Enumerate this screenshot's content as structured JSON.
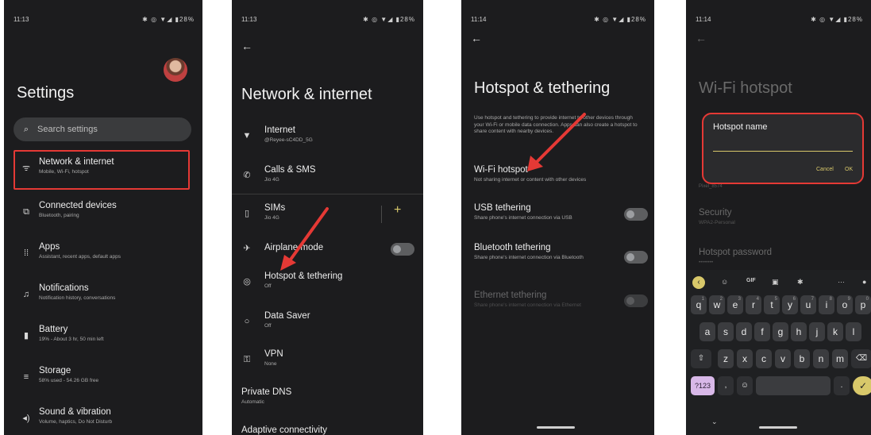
{
  "panel1": {
    "status_time": "11:13",
    "status_icons": "✱ ◎ ▼◢ ▮28%",
    "title": "Settings",
    "search_placeholder": "Search settings",
    "items": [
      {
        "title": "Network & internet",
        "sub": "Mobile, Wi-Fi, hotspot"
      },
      {
        "title": "Connected devices",
        "sub": "Bluetooth, pairing"
      },
      {
        "title": "Apps",
        "sub": "Assistant, recent apps, default apps"
      },
      {
        "title": "Notifications",
        "sub": "Notification history, conversations"
      },
      {
        "title": "Battery",
        "sub": "19% - About 3 hr, 50 min left"
      },
      {
        "title": "Storage",
        "sub": "58% used - 54.26 GB free"
      },
      {
        "title": "Sound & vibration",
        "sub": "Volume, haptics, Do Not Disturb"
      }
    ]
  },
  "panel2": {
    "status_time": "11:13",
    "status_icons": "✱ ◎ ▼◢ ▮28%",
    "title": "Network & internet",
    "items": [
      {
        "title": "Internet",
        "sub": "@Reyee-sC4DD_5G"
      },
      {
        "title": "Calls & SMS",
        "sub": "Jio 4G"
      },
      {
        "title": "SIMs",
        "sub": "Jio 4G"
      },
      {
        "title": "Airplane mode",
        "sub": ""
      },
      {
        "title": "Hotspot & tethering",
        "sub": "Off"
      },
      {
        "title": "Data Saver",
        "sub": "Off"
      },
      {
        "title": "VPN",
        "sub": "None"
      },
      {
        "title": "Private DNS",
        "sub": "Automatic"
      },
      {
        "title": "Adaptive connectivity",
        "sub": ""
      }
    ]
  },
  "panel3": {
    "status_time": "11:14",
    "status_icons": "✱ ◎ ▼◢ ▮28%",
    "title": "Hotspot & tethering",
    "description": "Use hotspot and tethering to provide internet to other devices through your Wi-Fi or mobile data connection. Apps can also create a hotspot to share content with nearby devices.",
    "wifi_title": "Wi-Fi hotspot",
    "wifi_sub": "Not sharing internet or content with other devices",
    "usb_title": "USB tethering",
    "usb_sub": "Share phone's internet connection via USB",
    "bt_title": "Bluetooth tethering",
    "bt_sub": "Share phone's internet connection via Bluetooth",
    "eth_title": "Ethernet tethering",
    "eth_sub": "Share phone's internet connection via Ethernet"
  },
  "panel4": {
    "status_time": "11:14",
    "status_icons": "✱ ◎ ▼◢ ▮28%",
    "title": "Wi-Fi hotspot",
    "dialog_title": "Hotspot name",
    "cancel": "Cancel",
    "ok": "OK",
    "bg_name_value": "Pixel_8574",
    "security_title": "Security",
    "security_sub": "WPA2-Personal",
    "password_title": "Hotspot password",
    "password_sub": "••••••••",
    "toolbar": {
      "gif": "GIF"
    },
    "keys_row1": [
      "q",
      "w",
      "e",
      "r",
      "t",
      "y",
      "u",
      "i",
      "o",
      "p"
    ],
    "keys_row1_hints": [
      "1",
      "2",
      "3",
      "4",
      "5",
      "6",
      "7",
      "8",
      "9",
      "0"
    ],
    "keys_row2": [
      "a",
      "s",
      "d",
      "f",
      "g",
      "h",
      "j",
      "k",
      "l"
    ],
    "keys_row3": [
      "z",
      "x",
      "c",
      "v",
      "b",
      "n",
      "m"
    ],
    "sym_key": "?123",
    "comma": ",",
    "period": "."
  },
  "colors": {
    "accent_red": "#e53935",
    "accent_yellow": "#d8c86a",
    "background": "#1c1c1e"
  }
}
